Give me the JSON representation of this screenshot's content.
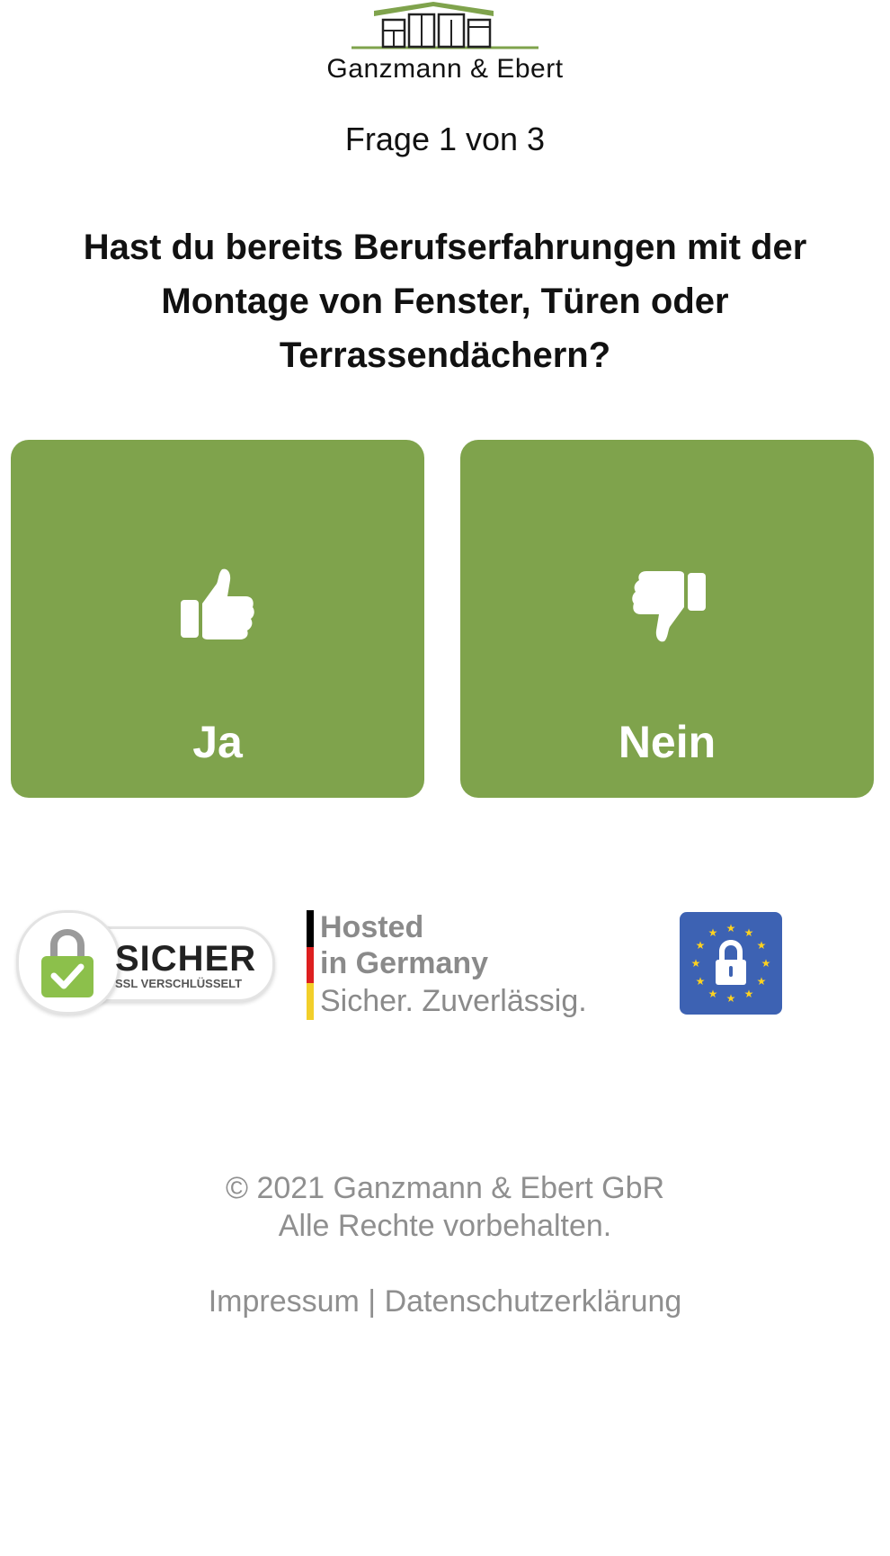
{
  "brand": {
    "name": "Ganzmann & Ebert",
    "color": "#7fa34c"
  },
  "quiz": {
    "progress": "Frage 1 von 3",
    "question": "Hast du bereits Berufserfahrungen mit der Montage von Fenster, Türen oder Terrassendächern?",
    "answers": [
      {
        "label": "Ja",
        "icon": "thumbs-up-icon"
      },
      {
        "label": "Nein",
        "icon": "thumbs-down-icon"
      }
    ]
  },
  "trust_badges": {
    "ssl": {
      "title": "SICHER",
      "subtitle": "SSL VERSCHLÜSSELT"
    },
    "hosted": {
      "line1": "Hosted",
      "line2": "in Germany",
      "line3": "Sicher. Zuverlässig."
    },
    "eu": {
      "icon": "eu-lock-icon"
    }
  },
  "footer": {
    "copyright": "© 2021 Ganzmann & Ebert GbR",
    "rights": "Alle Rechte vorbehalten.",
    "impressum": "Impressum",
    "separator": " | ",
    "privacy": "Datenschutzerklärung"
  }
}
